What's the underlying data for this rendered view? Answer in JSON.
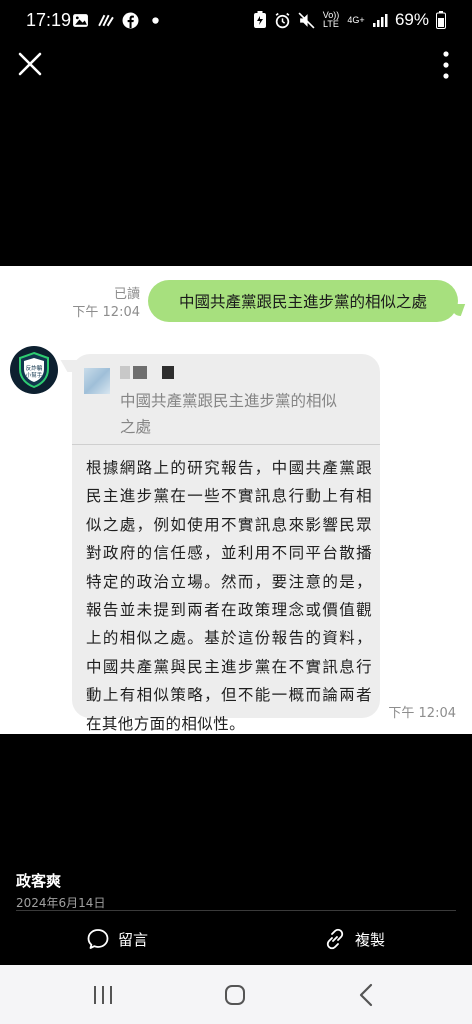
{
  "status_bar": {
    "time": "17:19",
    "volte": "Vo)) LTE",
    "network": "4G+",
    "battery": "69%"
  },
  "chat": {
    "sent": {
      "read_label": "已讀",
      "time": "下午 12:04",
      "text": "中國共產黨跟民主進步黨的相似之處"
    },
    "reply": {
      "avatar_text": "反詐騙 小幫手",
      "quoted_text": "中國共產黨跟民主進步黨的相似之處",
      "text": "根據網路上的研究報告，中國共產黨跟民主進步黨在一些不實訊息行動上有相似之處，例如使用不實訊息來影響民眾對政府的信任感，並利用不同平台散播特定的政治立場。然而，要注意的是，報告並未提到兩者在政策理念或價值觀上的相似之處。基於這份報告的資料，中國共產黨與民主進步黨在不實訊息行動上有相似策略，但不能一概而論兩者在其他方面的相似性。",
      "time": "下午 12:04"
    }
  },
  "post": {
    "author": "政客爽",
    "date": "2024年6月14日"
  },
  "actions": {
    "comment_label": "留言",
    "copy_label": "複製"
  },
  "icons": {
    "close": "close-icon",
    "more": "more-vertical-icon",
    "comment": "speech-bubble-icon",
    "copy": "link-icon"
  },
  "colors": {
    "sent_bubble": "#a7e07e",
    "received_bubble": "#ededed",
    "background": "#000000"
  }
}
